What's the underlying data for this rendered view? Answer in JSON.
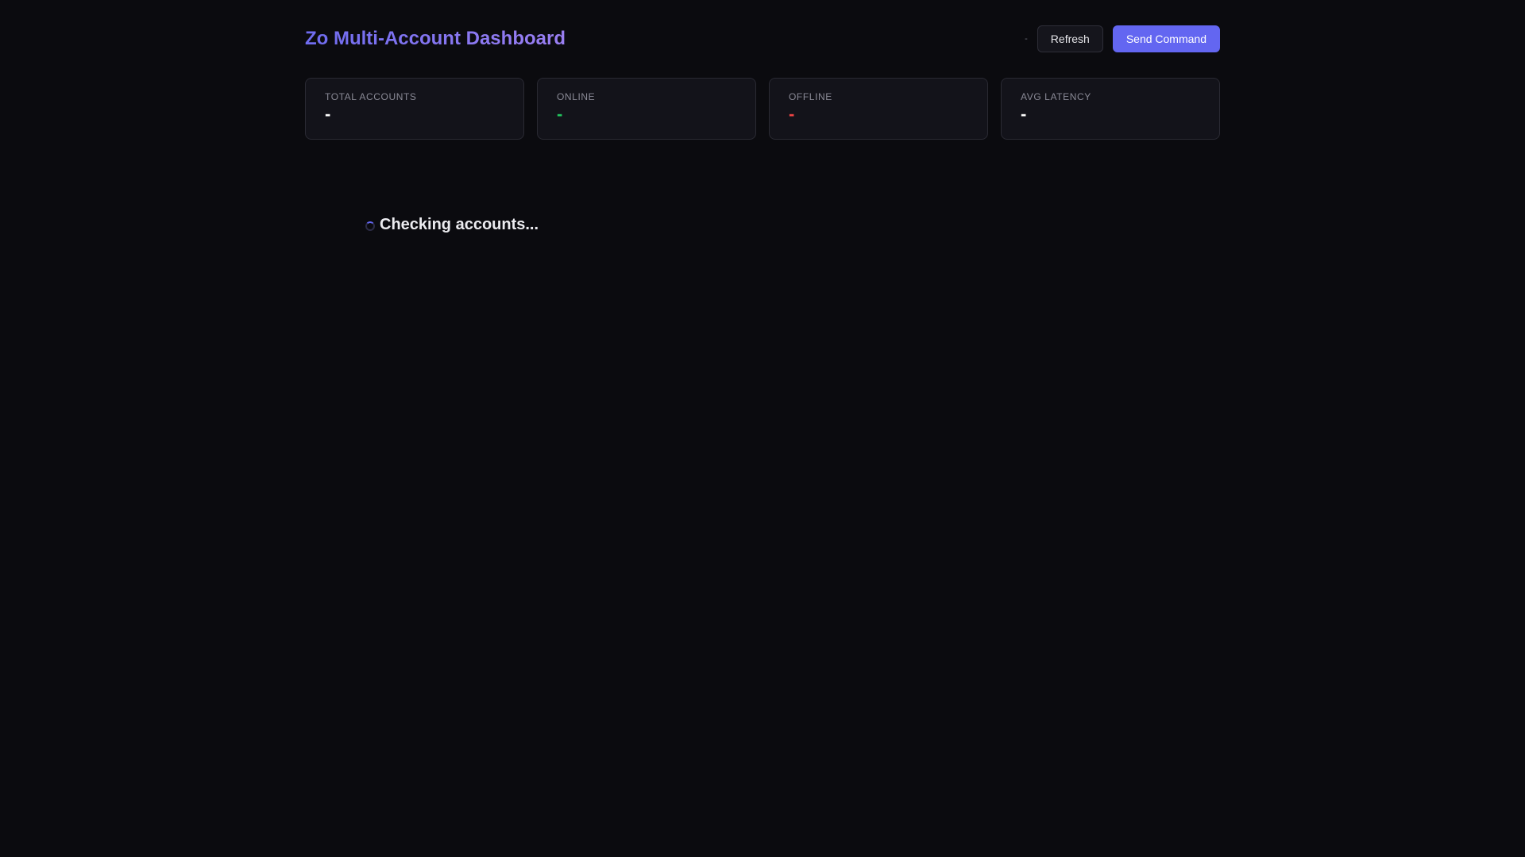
{
  "header": {
    "title": "Zo Multi-Account Dashboard",
    "last_updated": "-",
    "refresh_label": "Refresh",
    "send_command_label": "Send Command"
  },
  "stats": [
    {
      "label": "TOTAL ACCOUNTS",
      "value": "-",
      "color": "#ffffff"
    },
    {
      "label": "ONLINE",
      "value": "-",
      "color": "#22c55e"
    },
    {
      "label": "OFFLINE",
      "value": "-",
      "color": "#ef4444"
    },
    {
      "label": "AVG LATENCY",
      "value": "-",
      "color": "#ffffff"
    }
  ],
  "loading": {
    "text": "Checking accounts..."
  },
  "colors": {
    "accent": "#6366f1",
    "background": "#0b0b0f",
    "card": "#13131a"
  }
}
